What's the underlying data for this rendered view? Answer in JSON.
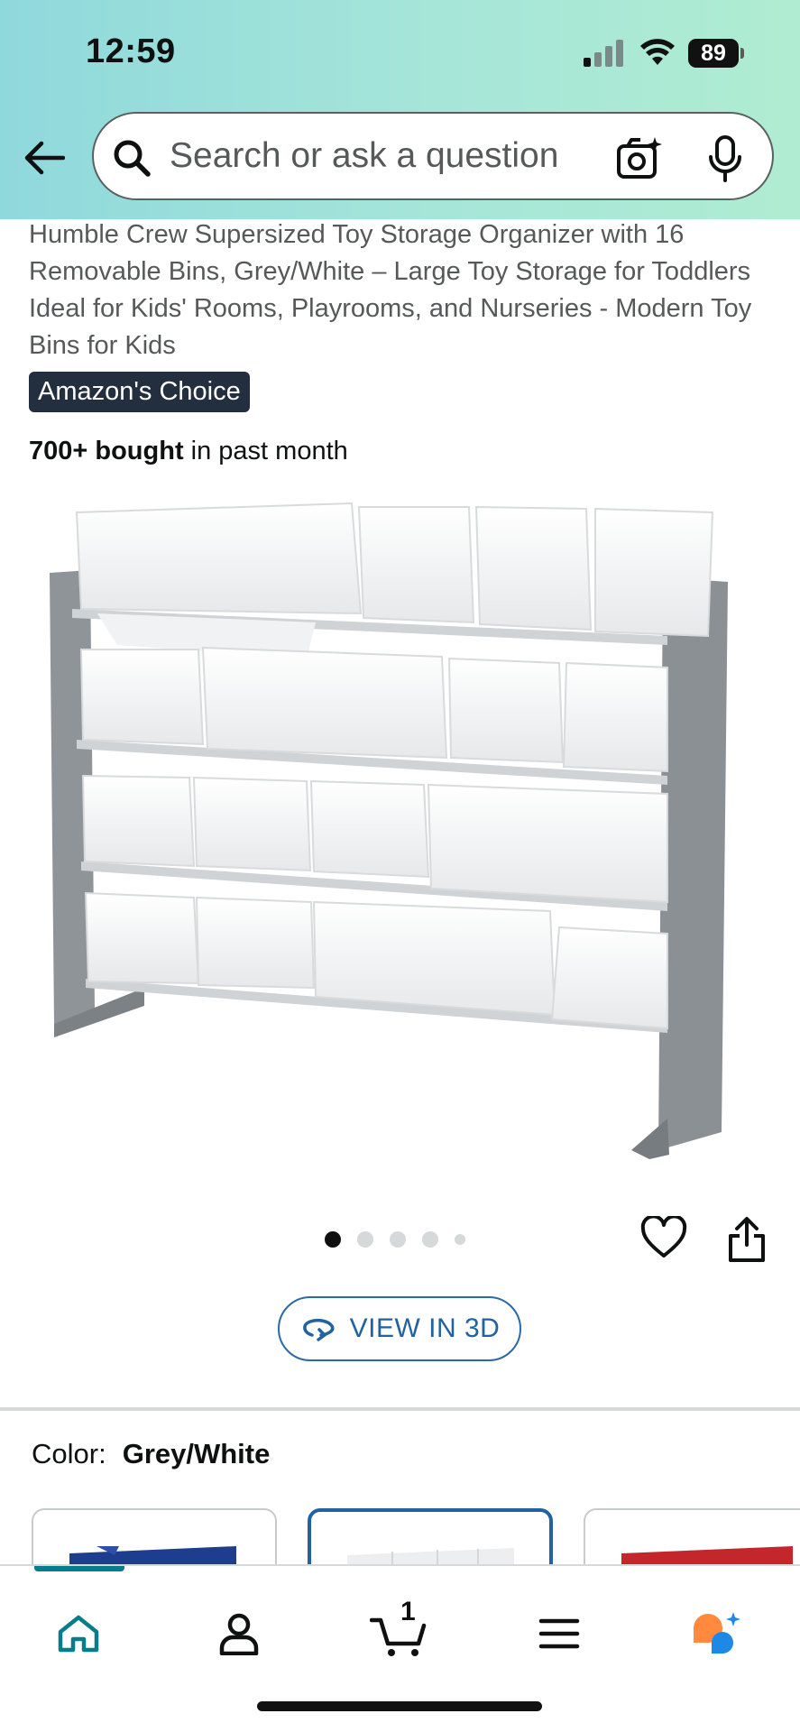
{
  "status_bar": {
    "time": "12:59",
    "battery": "89"
  },
  "search": {
    "placeholder": "Search or ask a question"
  },
  "product": {
    "title": "Humble Crew Supersized Toy Storage Organizer with 16 Removable Bins, Grey/White – Large Toy Storage for Toddlers Ideal for Kids' Rooms, Playrooms, and Nurseries - Modern Toy Bins for Kids",
    "badge": "Amazon's Choice",
    "bought_bold": "700+ bought",
    "bought_rest": " in past month",
    "image_count": 5,
    "active_image": 1
  },
  "view3d": {
    "label": "VIEW IN 3D"
  },
  "color": {
    "key": "Color:",
    "value": "Grey/White",
    "swatches": [
      "blue",
      "white",
      "red"
    ],
    "selected": "white"
  },
  "bottom_nav": {
    "items": [
      "home-icon",
      "account-icon",
      "cart-icon",
      "menu-icon",
      "rufus-icon"
    ],
    "cart_count": "1",
    "active": "home"
  },
  "colors": {
    "header_gradient_start": "#8fd8dc",
    "header_gradient_end": "#b0ecd2",
    "badge_bg": "#232f3e",
    "link_blue": "#2162a1",
    "active_teal": "#067d8a",
    "rufus_orange": "#ff8a3d",
    "rufus_blue": "#1e88e5"
  }
}
